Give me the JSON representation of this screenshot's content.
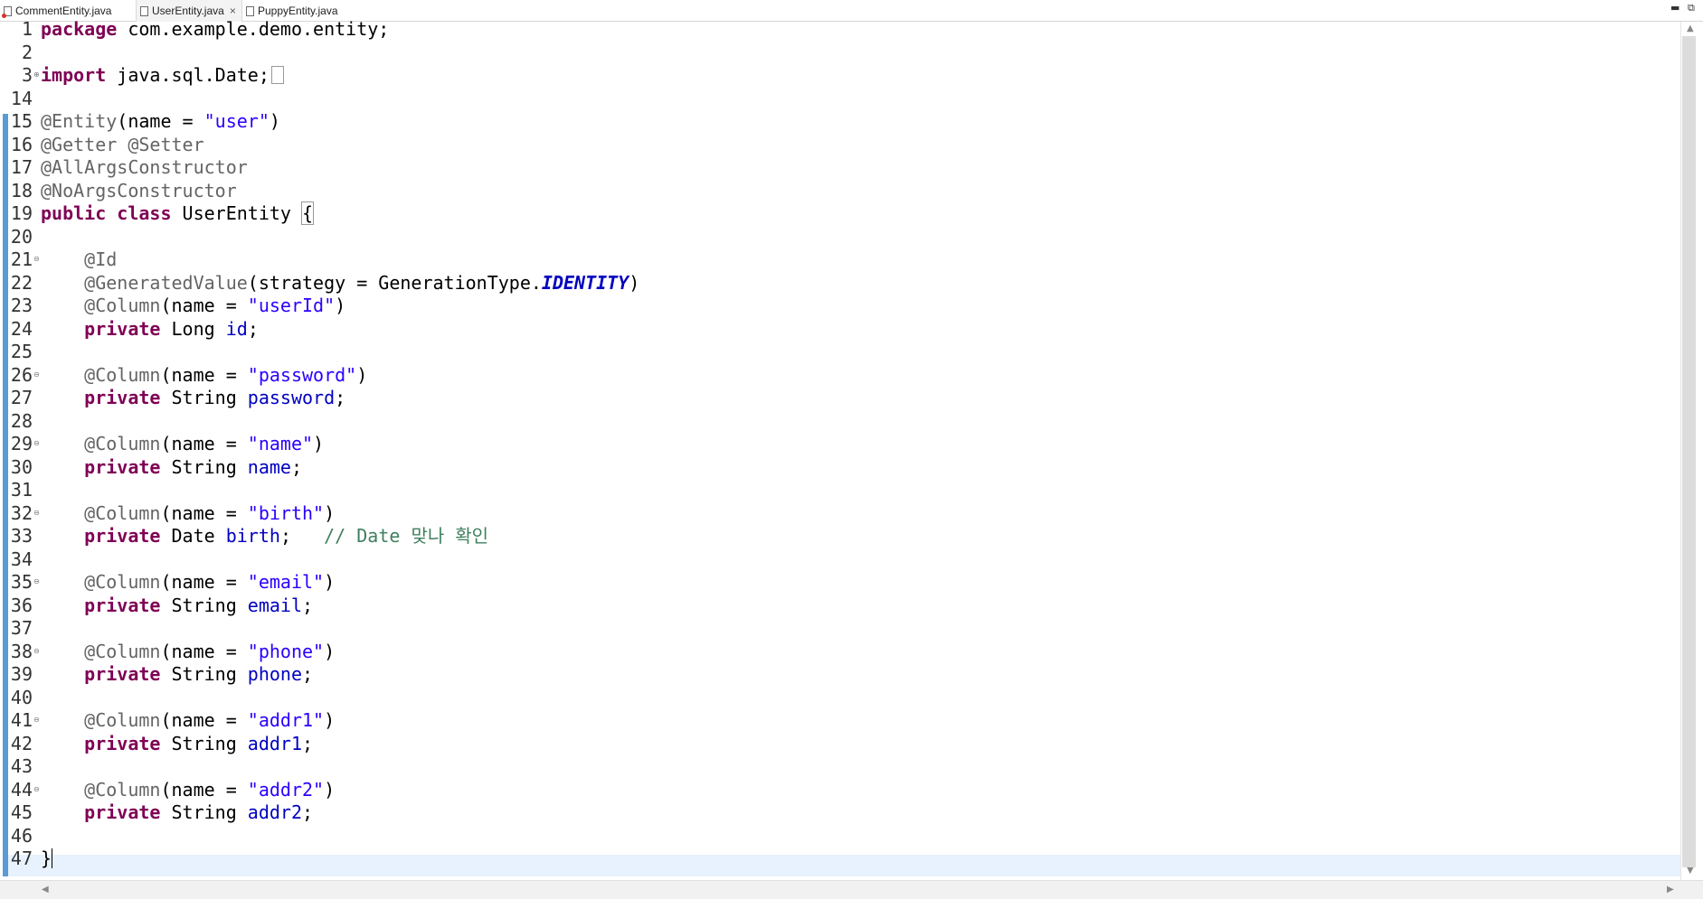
{
  "tabs": [
    {
      "label": "CommentEntity.java",
      "active": false,
      "has_error": true
    },
    {
      "label": "UserEntity.java",
      "active": true,
      "close": "×"
    },
    {
      "label": "PuppyEntity.java",
      "active": false
    }
  ],
  "window_controls": {
    "minimize": "▬",
    "restore": "⧉"
  },
  "editor": {
    "line_numbers": [
      "1",
      "2",
      "3",
      "14",
      "15",
      "16",
      "17",
      "18",
      "19",
      "20",
      "21",
      "22",
      "23",
      "24",
      "25",
      "26",
      "27",
      "28",
      "29",
      "30",
      "31",
      "32",
      "33",
      "34",
      "35",
      "36",
      "37",
      "38",
      "39",
      "40",
      "41",
      "42",
      "43",
      "44",
      "45",
      "46",
      "47"
    ],
    "fold_markers": {
      "3": "⊕",
      "21": "⊖",
      "26": "⊖",
      "29": "⊖",
      "32": "⊖",
      "35": "⊖",
      "38": "⊖",
      "41": "⊖",
      "44": "⊖"
    },
    "lines": [
      [
        {
          "t": "package",
          "c": "kw"
        },
        {
          "t": " com.example.demo.entity;"
        }
      ],
      [],
      [
        {
          "t": "import",
          "c": "kw"
        },
        {
          "t": " java.sql.Date;"
        }
      ],
      [],
      [
        {
          "t": "@Entity",
          "c": "an"
        },
        {
          "t": "(name = "
        },
        {
          "t": "\"user\"",
          "c": "st"
        },
        {
          "t": ")"
        }
      ],
      [
        {
          "t": "@Getter @Setter",
          "c": "an"
        }
      ],
      [
        {
          "t": "@AllArgsConstructor",
          "c": "an"
        }
      ],
      [
        {
          "t": "@NoArgsConstructor",
          "c": "an"
        }
      ],
      [
        {
          "t": "public",
          "c": "kw"
        },
        {
          "t": " "
        },
        {
          "t": "class",
          "c": "kw"
        },
        {
          "t": " UserEntity "
        },
        {
          "t": "{",
          "c": "brace"
        }
      ],
      [],
      [
        {
          "t": "    "
        },
        {
          "t": "@Id",
          "c": "an"
        }
      ],
      [
        {
          "t": "    "
        },
        {
          "t": "@GeneratedValue",
          "c": "an"
        },
        {
          "t": "(strategy = GenerationType."
        },
        {
          "t": "IDENTITY",
          "c": "sf"
        },
        {
          "t": ")"
        }
      ],
      [
        {
          "t": "    "
        },
        {
          "t": "@Column",
          "c": "an"
        },
        {
          "t": "(name = "
        },
        {
          "t": "\"userId\"",
          "c": "st"
        },
        {
          "t": ")"
        }
      ],
      [
        {
          "t": "    "
        },
        {
          "t": "private",
          "c": "kw"
        },
        {
          "t": " Long "
        },
        {
          "t": "id",
          "c": "fd"
        },
        {
          "t": ";"
        }
      ],
      [],
      [
        {
          "t": "    "
        },
        {
          "t": "@Column",
          "c": "an"
        },
        {
          "t": "(name = "
        },
        {
          "t": "\"password\"",
          "c": "st"
        },
        {
          "t": ")"
        }
      ],
      [
        {
          "t": "    "
        },
        {
          "t": "private",
          "c": "kw"
        },
        {
          "t": " String "
        },
        {
          "t": "password",
          "c": "fd"
        },
        {
          "t": ";"
        }
      ],
      [],
      [
        {
          "t": "    "
        },
        {
          "t": "@Column",
          "c": "an"
        },
        {
          "t": "(name = "
        },
        {
          "t": "\"name\"",
          "c": "st"
        },
        {
          "t": ")"
        }
      ],
      [
        {
          "t": "    "
        },
        {
          "t": "private",
          "c": "kw"
        },
        {
          "t": " String "
        },
        {
          "t": "name",
          "c": "fd"
        },
        {
          "t": ";"
        }
      ],
      [],
      [
        {
          "t": "    "
        },
        {
          "t": "@Column",
          "c": "an"
        },
        {
          "t": "(name = "
        },
        {
          "t": "\"birth\"",
          "c": "st"
        },
        {
          "t": ")"
        }
      ],
      [
        {
          "t": "    "
        },
        {
          "t": "private",
          "c": "kw"
        },
        {
          "t": " Date "
        },
        {
          "t": "birth",
          "c": "fd"
        },
        {
          "t": ";   "
        },
        {
          "t": "// Date 맞나 확인",
          "c": "cm"
        }
      ],
      [],
      [
        {
          "t": "    "
        },
        {
          "t": "@Column",
          "c": "an"
        },
        {
          "t": "(name = "
        },
        {
          "t": "\"email\"",
          "c": "st"
        },
        {
          "t": ")"
        }
      ],
      [
        {
          "t": "    "
        },
        {
          "t": "private",
          "c": "kw"
        },
        {
          "t": " String "
        },
        {
          "t": "email",
          "c": "fd"
        },
        {
          "t": ";"
        }
      ],
      [],
      [
        {
          "t": "    "
        },
        {
          "t": "@Column",
          "c": "an"
        },
        {
          "t": "(name = "
        },
        {
          "t": "\"phone\"",
          "c": "st"
        },
        {
          "t": ")"
        }
      ],
      [
        {
          "t": "    "
        },
        {
          "t": "private",
          "c": "kw"
        },
        {
          "t": " String "
        },
        {
          "t": "phone",
          "c": "fd"
        },
        {
          "t": ";"
        }
      ],
      [],
      [
        {
          "t": "    "
        },
        {
          "t": "@Column",
          "c": "an"
        },
        {
          "t": "(name = "
        },
        {
          "t": "\"addr1\"",
          "c": "st"
        },
        {
          "t": ")"
        }
      ],
      [
        {
          "t": "    "
        },
        {
          "t": "private",
          "c": "kw"
        },
        {
          "t": " String "
        },
        {
          "t": "addr1",
          "c": "fd"
        },
        {
          "t": ";"
        }
      ],
      [],
      [
        {
          "t": "    "
        },
        {
          "t": "@Column",
          "c": "an"
        },
        {
          "t": "(name = "
        },
        {
          "t": "\"addr2\"",
          "c": "st"
        },
        {
          "t": ")"
        }
      ],
      [
        {
          "t": "    "
        },
        {
          "t": "private",
          "c": "kw"
        },
        {
          "t": " String "
        },
        {
          "t": "addr2",
          "c": "fd"
        },
        {
          "t": ";"
        }
      ],
      [],
      [
        {
          "t": "}"
        }
      ]
    ]
  },
  "colors": {
    "keyword": "#7f0055",
    "annotation": "#646464",
    "string": "#2a00ff",
    "field": "#0000c0",
    "comment": "#3f7f5f",
    "ruler": "#5b9bd5",
    "current_line": "#e8f2fe"
  }
}
